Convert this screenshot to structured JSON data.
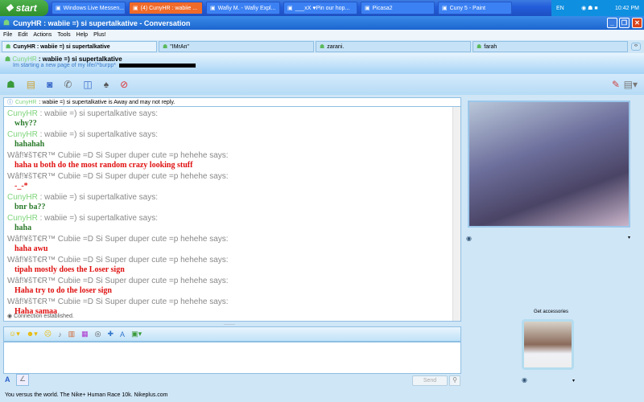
{
  "taskbar": {
    "start": "start",
    "tasks": [
      {
        "label": "Windows Live Messen...",
        "active": false
      },
      {
        "label": "(4) CunyHR : wabiie ...",
        "active": true
      },
      {
        "label": "Wafiy M. - Wafiy Expl...",
        "active": false
      },
      {
        "label": "___xX ♥Pin our hop...",
        "active": false
      },
      {
        "label": "Picasa2",
        "active": false
      },
      {
        "label": "Cuny 5 - Paint",
        "active": false
      }
    ],
    "lang": "EN",
    "clock": "10:42 PM"
  },
  "window": {
    "title": "CunyHR : wabiie =) si supertalkative - Conversation"
  },
  "menu": [
    "File",
    "Edit",
    "Actions",
    "Tools",
    "Help",
    "Plus!"
  ],
  "tabs": [
    "CunyHR : wabiie =) si supertalkative",
    "\"IMrAn\"",
    "zarani.",
    "farah"
  ],
  "contact": {
    "name_colored": "CunyHR",
    "name_rest": " : wabiie =) si supertalkative",
    "personal_message": "Im starting a new page of my life//*burpp*"
  },
  "away_notice": {
    "name": "CunyHR",
    "text": " : wabiie =) si supertalkative is Away and may not reply."
  },
  "messages": [
    {
      "name": "CunyHR",
      "rest": " : wabiie =) si supertalkative says:",
      "text": "why??",
      "color": "#2a7a2a"
    },
    {
      "name": "CunyHR",
      "rest": " : wabiie =) si supertalkative says:",
      "text": "hahahah",
      "color": "#2a7a2a"
    },
    {
      "name": "",
      "rest": "Wâf!¥šT€R™ Cubiie =D Si Super duper cute =p hehehe says:",
      "text": "haha u both do the most random crazy looking stuff",
      "color": "#e01010"
    },
    {
      "name": "",
      "rest": "Wâf!¥šT€R™ Cubiie =D Si Super duper cute =p hehehe says:",
      "text": "-_-*",
      "color": "#e01010"
    },
    {
      "name": "CunyHR",
      "rest": " : wabiie =) si supertalkative says:",
      "text": "bnr ba??",
      "color": "#2a7a2a"
    },
    {
      "name": "CunyHR",
      "rest": " : wabiie =) si supertalkative says:",
      "text": "haha",
      "color": "#2a7a2a"
    },
    {
      "name": "",
      "rest": "Wâf!¥šT€R™ Cubiie =D Si Super duper cute =p hehehe says:",
      "text": "haha awu",
      "color": "#e01010"
    },
    {
      "name": "",
      "rest": "Wâf!¥šT€R™ Cubiie =D Si Super duper cute =p hehehe says:",
      "text": "tipah mostly does the Loser sign",
      "color": "#e01010"
    },
    {
      "name": "",
      "rest": "Wâf!¥šT€R™ Cubiie =D Si Super duper cute =p hehehe says:",
      "text": "Haha try to do the loser sign",
      "color": "#e01010"
    },
    {
      "name": "",
      "rest": "Wâf!¥šT€R™ Cubiie =D Si Super duper cute =p hehehe says:",
      "text": "Haha samaa",
      "color": "#e01010"
    }
  ],
  "status": "Connection established.",
  "send": "Send",
  "accessories": "Get accessories",
  "footer": "You versus the world. The Nike+ Human Race 10k. Nikeplus.com"
}
